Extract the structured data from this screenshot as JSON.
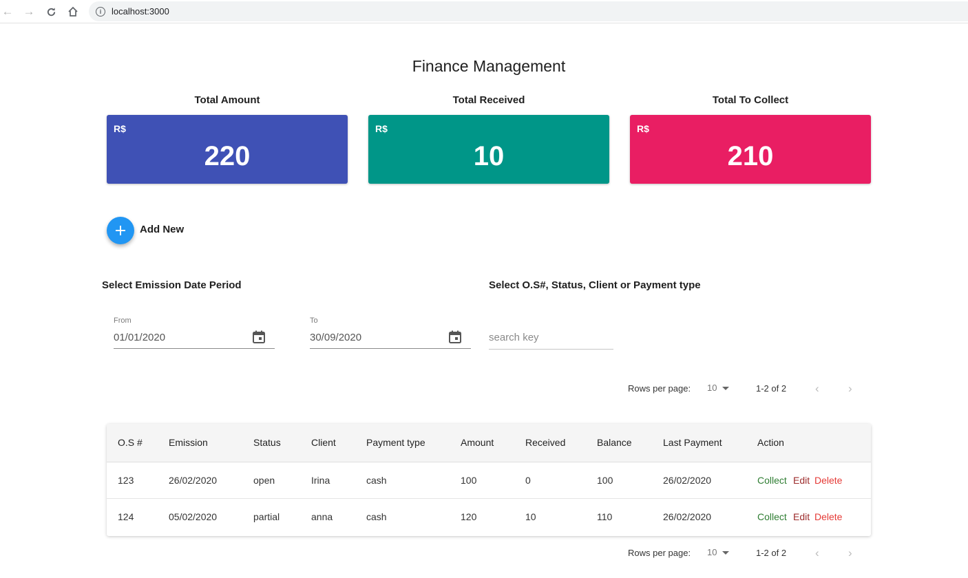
{
  "browser": {
    "url": "localhost:3000"
  },
  "page": {
    "title": "Finance Management"
  },
  "cards": [
    {
      "label": "Total Amount",
      "currency": "R$",
      "value": "220",
      "color": "#3f51b5"
    },
    {
      "label": "Total Received",
      "currency": "R$",
      "value": "10",
      "color": "#009688"
    },
    {
      "label": "Total To Collect",
      "currency": "R$",
      "value": "210",
      "color": "#e91e63"
    }
  ],
  "add_new": {
    "label": "Add New",
    "icon": "plus-icon"
  },
  "filters": {
    "date_section_label": "Select Emission Date Period",
    "search_section_label": "Select O.S#, Status, Client or Payment type",
    "from": {
      "label": "From",
      "value": "01/01/2020"
    },
    "to": {
      "label": "To",
      "value": "30/09/2020"
    },
    "search": {
      "placeholder": "search key"
    }
  },
  "pagination": {
    "rows_per_page_label": "Rows per page:",
    "rows_per_page": "10",
    "range": "1-2 of 2"
  },
  "table": {
    "columns": [
      "O.S #",
      "Emission",
      "Status",
      "Client",
      "Payment type",
      "Amount",
      "Received",
      "Balance",
      "Last Payment",
      "Action"
    ],
    "rows": [
      [
        "123",
        "26/02/2020",
        "open",
        "Irina",
        "cash",
        "100",
        "0",
        "100",
        "26/02/2020"
      ],
      [
        "124",
        "05/02/2020",
        "partial",
        "anna",
        "cash",
        "120",
        "10",
        "110",
        "26/02/2020"
      ]
    ],
    "actions": {
      "collect": "Collect",
      "edit": "Edit",
      "delete": "Delete"
    }
  }
}
